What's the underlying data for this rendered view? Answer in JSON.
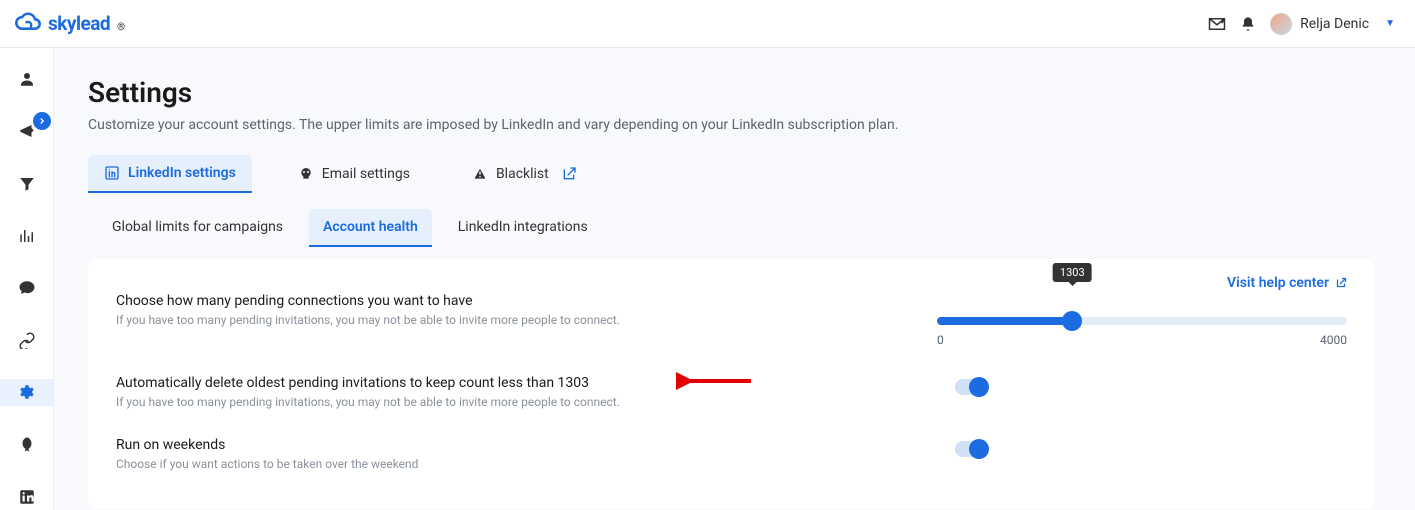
{
  "brand": {
    "name": "skylead"
  },
  "user": {
    "name": "Relja Denic"
  },
  "page": {
    "title": "Settings",
    "subtitle": "Customize your account settings. The upper limits are imposed by LinkedIn and vary depending on your LinkedIn subscription plan."
  },
  "tabs_primary": {
    "linkedin": "LinkedIn settings",
    "email": "Email settings",
    "blacklist": "Blacklist"
  },
  "tabs_secondary": {
    "global": "Global limits for campaigns",
    "health": "Account health",
    "integrations": "LinkedIn integrations"
  },
  "help_link": "Visit help center",
  "settings": {
    "pending": {
      "title": "Choose how many pending connections you want to have",
      "sub": "If you have too many pending invitations, you may not be able to invite more people to connect.",
      "value": "1303",
      "min": "0",
      "max": "4000"
    },
    "autodelete": {
      "title": "Automatically delete oldest pending invitations to keep count less than 1303",
      "sub": "If you have too many pending invitations, you may not be able to invite more people to connect."
    },
    "weekends": {
      "title": "Run on weekends",
      "sub": "Choose if you want actions to be taken over the weekend"
    }
  }
}
